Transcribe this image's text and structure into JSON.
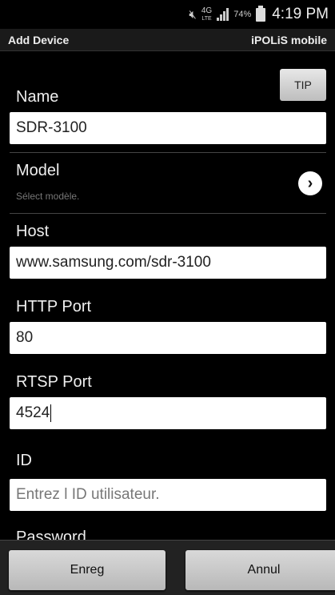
{
  "status_bar": {
    "network_label_top": "4G",
    "network_label_bottom": "LTE",
    "battery_percent": "74%",
    "time": "4:19 PM",
    "icons": [
      "mute-icon",
      "signal-icon",
      "battery-icon"
    ]
  },
  "app_bar": {
    "title": "Add Device",
    "brand": "iPOLiS mobile"
  },
  "form": {
    "tip_label": "TIP",
    "name": {
      "label": "Name",
      "value": "SDR-3100"
    },
    "model": {
      "label": "Model",
      "hint": "Sélect modèle."
    },
    "host": {
      "label": "Host",
      "value": "www.samsung.com/sdr-3100"
    },
    "http_port": {
      "label": "HTTP Port",
      "value": "80"
    },
    "rtsp_port": {
      "label": "RTSP Port",
      "value": "4524"
    },
    "id": {
      "label": "ID",
      "placeholder": "Entrez l ID utilisateur."
    },
    "password": {
      "label": "Password"
    }
  },
  "buttons": {
    "save_label": "Enreg",
    "cancel_label": "Annul"
  },
  "colors": {
    "background": "#000000",
    "input_bg": "#ffffff",
    "button_bg": "#cccccc"
  }
}
